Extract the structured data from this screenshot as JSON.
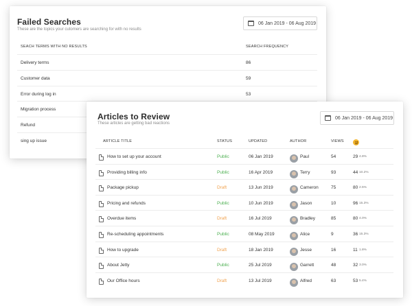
{
  "failed_searches": {
    "title": "Failed Searches",
    "subtitle": "These are the topics your cutomers are searching for with no results",
    "date_range": "06 Jan 2019 - 06 Aug 2019",
    "columns": [
      "SEACH TERMS WITH NO RESULTS",
      "SEARCH FREQUENCY"
    ],
    "rows": [
      {
        "term": "Delivery terms",
        "frequency": "86"
      },
      {
        "term": "Customer data",
        "frequency": "59"
      },
      {
        "term": "Error during log in",
        "frequency": "53"
      },
      {
        "term": "Migration process",
        "frequency": ""
      },
      {
        "term": "Refund",
        "frequency": ""
      },
      {
        "term": "sing up issue",
        "frequency": ""
      }
    ]
  },
  "articles_to_review": {
    "title": "Articles to Review",
    "subtitle": "These articles are getting bad reactions",
    "date_range": "06 Jan 2019 - 06 Aug 2019",
    "columns": {
      "title": "ARTICLE TITLE",
      "status": "STATUS",
      "updated": "UPDATED",
      "author": "AUTHOR",
      "views": "VIEWS",
      "reaction_icon": "sad-face-icon"
    },
    "status_colors": {
      "Public": "#4caf50",
      "Draft": "#f0a04b"
    },
    "rows": [
      {
        "title": "How to set up your account",
        "status": "Public",
        "updated": "06 Jan 2019",
        "author": "Paul",
        "views": "54",
        "bad": "29",
        "pct": "4.8%"
      },
      {
        "title": "Providing billing info",
        "status": "Public",
        "updated": "16 Apr 2019",
        "author": "Terry",
        "views": "93",
        "bad": "44",
        "pct": "10.2%"
      },
      {
        "title": "Package pickup",
        "status": "Draft",
        "updated": "13 Jun 2019",
        "author": "Cameron",
        "views": "75",
        "bad": "80",
        "pct": "2.5%"
      },
      {
        "title": "Pricing and refunds",
        "status": "Public",
        "updated": "10 Jun 2019",
        "author": "Jason",
        "views": "10",
        "bad": "96",
        "pct": "15.3%"
      },
      {
        "title": "Overdue items",
        "status": "Draft",
        "updated": "16 Jul 2019",
        "author": "Bradley",
        "views": "85",
        "bad": "80",
        "pct": "4.0%"
      },
      {
        "title": "Re-scheduling appointments",
        "status": "Public",
        "updated": "08 May 2019",
        "author": "Alice",
        "views": "9",
        "bad": "36",
        "pct": "15.3%"
      },
      {
        "title": "How to upgrade",
        "status": "Draft",
        "updated": "18 Jan 2019",
        "author": "Jesse",
        "views": "16",
        "bad": "11",
        "pct": "1.8%"
      },
      {
        "title": "About Jetty",
        "status": "Public",
        "updated": "25 Jul 2019",
        "author": "Garrett",
        "views": "48",
        "bad": "32",
        "pct": "3.0%"
      },
      {
        "title": "Our Office hours",
        "status": "Draft",
        "updated": "13 Jul 2019",
        "author": "Alfred",
        "views": "63",
        "bad": "53",
        "pct": "5.4%"
      }
    ]
  }
}
